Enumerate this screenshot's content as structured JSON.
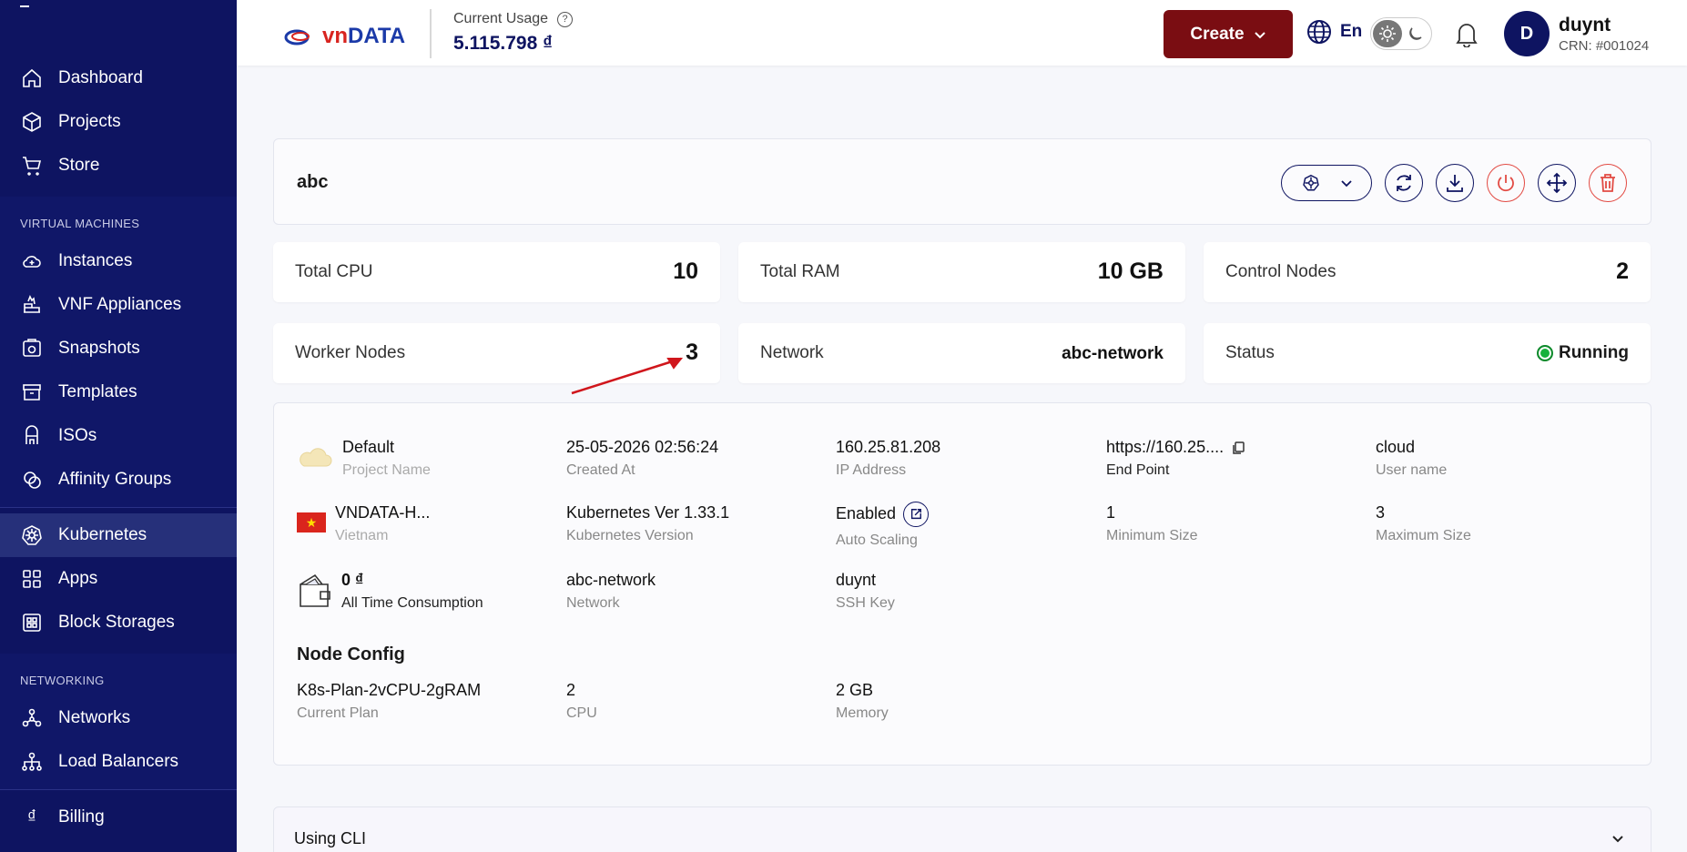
{
  "sidebar": {
    "items_top": [
      {
        "label": "Dashboard",
        "icon": "home-icon"
      },
      {
        "label": "Projects",
        "icon": "cube-icon"
      },
      {
        "label": "Store",
        "icon": "cart-icon"
      }
    ],
    "vm_title": "VIRTUAL MACHINES",
    "vm_items": [
      {
        "label": "Instances",
        "icon": "cloud-plus-icon"
      },
      {
        "label": "VNF Appliances",
        "icon": "firewall-icon"
      },
      {
        "label": "Snapshots",
        "icon": "camera-icon"
      },
      {
        "label": "Templates",
        "icon": "box-icon"
      },
      {
        "label": "ISOs",
        "icon": "disc-icon"
      },
      {
        "label": "Affinity Groups",
        "icon": "affinity-icon"
      }
    ],
    "k8s_items": [
      {
        "label": "Kubernetes",
        "icon": "kubernetes-icon"
      },
      {
        "label": "Apps",
        "icon": "apps-icon"
      },
      {
        "label": "Block Storages",
        "icon": "storage-icon"
      }
    ],
    "net_title": "NETWORKING",
    "net_items": [
      {
        "label": "Networks",
        "icon": "network-icon"
      },
      {
        "label": "Load Balancers",
        "icon": "load-balancer-icon"
      }
    ],
    "billing": {
      "label": "Billing",
      "icon": "dong-icon"
    }
  },
  "header": {
    "logo_vn": "vn",
    "logo_rest": "DATA",
    "usage_label": "Current Usage",
    "usage_value": "5.115.798 ₫",
    "create_label": "Create",
    "lang": "En",
    "user_initial": "D",
    "user_name": "duynt",
    "user_crn": "CRN: #001024"
  },
  "cluster": {
    "name": "abc"
  },
  "stats": {
    "total_cpu_label": "Total CPU",
    "total_cpu": "10",
    "total_ram_label": "Total RAM",
    "total_ram": "10 GB",
    "control_nodes_label": "Control Nodes",
    "control_nodes": "2",
    "worker_nodes_label": "Worker Nodes",
    "worker_nodes": "3",
    "network_label": "Network",
    "network": "abc-network",
    "status_label": "Status",
    "status": "Running"
  },
  "details": {
    "project": "Default",
    "project_label": "Project Name",
    "created": "25-05-2026 02:56:24",
    "created_label": "Created At",
    "ip": "160.25.81.208",
    "ip_label": "IP Address",
    "endpoint": "https://160.25....",
    "endpoint_label": "End Point",
    "user": "cloud",
    "user_label": "User name",
    "zone": "VNDATA-H...",
    "zone_label": "Vietnam",
    "k8s_ver": "Kubernetes Ver 1.33.1",
    "k8s_ver_label": "Kubernetes Version",
    "autoscale": "Enabled",
    "autoscale_label": "Auto Scaling",
    "min_size": "1",
    "min_size_label": "Minimum Size",
    "max_size": "3",
    "max_size_label": "Maximum Size",
    "consumption": "0 ₫",
    "consumption_label": "All Time Consumption",
    "network": "abc-network",
    "network_label": "Network",
    "ssh": "duynt",
    "ssh_label": "SSH Key"
  },
  "node_config": {
    "title": "Node Config",
    "plan": "K8s-Plan-2vCPU-2gRAM",
    "plan_label": "Current Plan",
    "cpu": "2",
    "cpu_label": "CPU",
    "memory": "2 GB",
    "memory_label": "Memory"
  },
  "cli": {
    "title": "Using CLI"
  },
  "colors": {
    "sidebar": "#0e1461",
    "create_button": "#7a0d12",
    "danger": "#e24a43",
    "running": "#17b13c"
  }
}
